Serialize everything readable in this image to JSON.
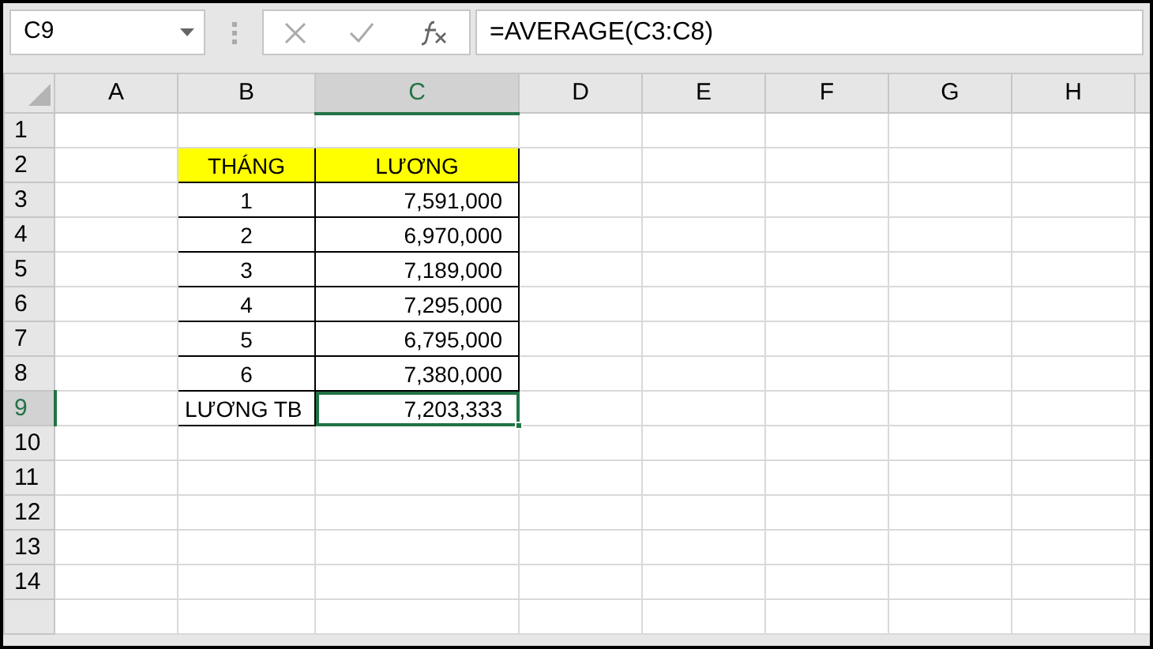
{
  "name_box": "C9",
  "formula": "=AVERAGE(C3:C8)",
  "columns": [
    {
      "label": "A",
      "selected": false
    },
    {
      "label": "B",
      "selected": false
    },
    {
      "label": "C",
      "selected": true
    },
    {
      "label": "D",
      "selected": false
    },
    {
      "label": "E",
      "selected": false
    },
    {
      "label": "F",
      "selected": false
    },
    {
      "label": "G",
      "selected": false
    },
    {
      "label": "H",
      "selected": false
    }
  ],
  "rows": [
    {
      "label": "1",
      "selected": false,
      "cells": []
    },
    {
      "label": "2",
      "selected": false,
      "cells": [
        {
          "text": "THÁNG",
          "kind": "title",
          "selected": false
        },
        {
          "text": "LƯƠNG",
          "kind": "title",
          "selected": false
        }
      ]
    },
    {
      "label": "3",
      "selected": false,
      "cells": [
        {
          "text": "1",
          "kind": "month",
          "selected": false
        },
        {
          "text": "7,591,000",
          "kind": "amount",
          "selected": false
        }
      ]
    },
    {
      "label": "4",
      "selected": false,
      "cells": [
        {
          "text": "2",
          "kind": "month",
          "selected": false
        },
        {
          "text": "6,970,000",
          "kind": "amount",
          "selected": false
        }
      ]
    },
    {
      "label": "5",
      "selected": false,
      "cells": [
        {
          "text": "3",
          "kind": "month",
          "selected": false
        },
        {
          "text": "7,189,000",
          "kind": "amount",
          "selected": false
        }
      ]
    },
    {
      "label": "6",
      "selected": false,
      "cells": [
        {
          "text": "4",
          "kind": "month",
          "selected": false
        },
        {
          "text": "7,295,000",
          "kind": "amount",
          "selected": false
        }
      ]
    },
    {
      "label": "7",
      "selected": false,
      "cells": [
        {
          "text": "5",
          "kind": "month",
          "selected": false
        },
        {
          "text": "6,795,000",
          "kind": "amount",
          "selected": false
        }
      ]
    },
    {
      "label": "8",
      "selected": false,
      "cells": [
        {
          "text": "6",
          "kind": "month",
          "selected": false
        },
        {
          "text": "7,380,000",
          "kind": "amount",
          "selected": false
        }
      ]
    },
    {
      "label": "9",
      "selected": true,
      "cells": [
        {
          "text": "LƯƠNG TB",
          "kind": "label",
          "selected": false
        },
        {
          "text": "7,203,333",
          "kind": "amount",
          "selected": true
        }
      ]
    },
    {
      "label": "10",
      "selected": false,
      "cells": []
    },
    {
      "label": "11",
      "selected": false,
      "cells": []
    },
    {
      "label": "12",
      "selected": false,
      "cells": []
    },
    {
      "label": "13",
      "selected": false,
      "cells": []
    },
    {
      "label": "14",
      "selected": false,
      "cells": []
    }
  ]
}
